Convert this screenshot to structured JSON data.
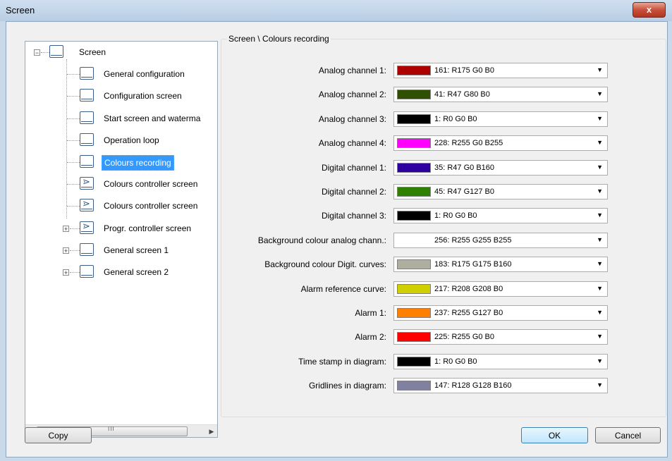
{
  "window": {
    "title": "Screen",
    "close_label": "x"
  },
  "tree": {
    "root": "Screen",
    "items": [
      {
        "label": "General configuration",
        "icon": "screen-icon"
      },
      {
        "label": "Configuration screen",
        "icon": "screen-icon"
      },
      {
        "label": "Start screen and watermа",
        "icon": "screen-icon"
      },
      {
        "label": "Operation loop",
        "icon": "screen-icon"
      },
      {
        "label": "Colours recording",
        "icon": "screen-icon",
        "selected": true
      },
      {
        "label": "Colours controller screen",
        "icon": "controller-screen-icon"
      },
      {
        "label": "Colours controller screen",
        "icon": "controller-screen-icon"
      },
      {
        "label": "Progr. controller screen",
        "icon": "controller-screen-icon"
      },
      {
        "label": "General screen 1",
        "icon": "screen-icon"
      },
      {
        "label": "General screen 2",
        "icon": "screen-icon"
      }
    ],
    "scroll_grip": "III"
  },
  "panel": {
    "title": "Screen \\ Colours recording",
    "rows": [
      {
        "label": "Analog channel 1:",
        "value": "161: R175 G0 B0",
        "color": "#af0000"
      },
      {
        "label": "Analog channel 2:",
        "value": "41: R47 G80 B0",
        "color": "#2f5000"
      },
      {
        "label": "Analog channel 3:",
        "value": "1: R0 G0 B0",
        "color": "#000000"
      },
      {
        "label": "Analog channel 4:",
        "value": "228: R255 G0 B255",
        "color": "#ff00ff"
      },
      {
        "label": "Digital channel 1:",
        "value": "35: R47 G0 B160",
        "color": "#2f00a0"
      },
      {
        "label": "Digital channel 2:",
        "value": "45: R47 G127 B0",
        "color": "#2f7f00"
      },
      {
        "label": "Digital channel 3:",
        "value": "1: R0 G0 B0",
        "color": "#000000"
      },
      {
        "label": "Background colour analog chann.:",
        "value": "256: R255 G255 B255",
        "color": "#ffffff"
      },
      {
        "label": "Background colour Digit. curves:",
        "value": "183: R175 G175 B160",
        "color": "#afafa0"
      },
      {
        "label": "Alarm reference curve:",
        "value": "217: R208 G208 B0",
        "color": "#d0d000"
      },
      {
        "label": "Alarm 1:",
        "value": "237: R255 G127 B0",
        "color": "#ff7f00"
      },
      {
        "label": "Alarm 2:",
        "value": "225: R255 G0 B0",
        "color": "#ff0000"
      },
      {
        "label": "Time stamp in diagram:",
        "value": "1: R0 G0 B0",
        "color": "#000000"
      },
      {
        "label": "Gridlines in diagram:",
        "value": "147: R128 G128 B160",
        "color": "#8080a0"
      }
    ]
  },
  "buttons": {
    "copy": "Copy",
    "ok": "OK",
    "cancel": "Cancel"
  }
}
